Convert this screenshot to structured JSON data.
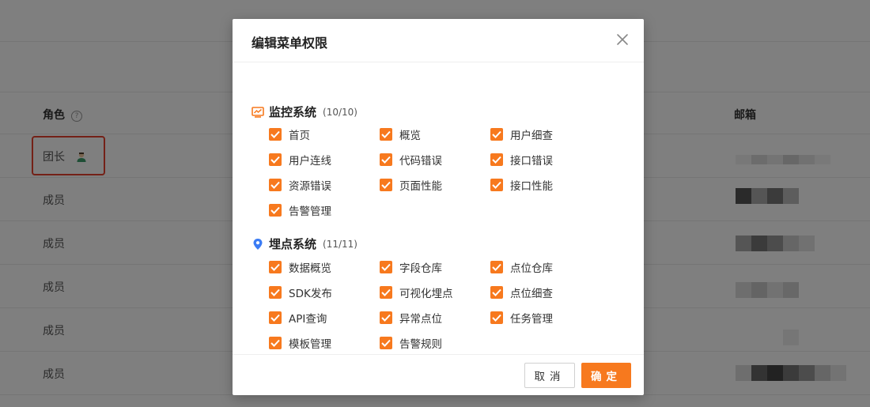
{
  "background": {
    "columns": {
      "role": "角色",
      "email": "邮箱"
    },
    "help_icon": "?",
    "rows": [
      {
        "role": "团长",
        "is_leader": true
      },
      {
        "role": "成员"
      },
      {
        "role": "成员"
      },
      {
        "role": "成员"
      },
      {
        "role": "成员"
      },
      {
        "role": "成员"
      }
    ]
  },
  "modal": {
    "title": "编辑菜单权限",
    "close_icon": "close-icon",
    "sections": [
      {
        "name": "监控系统",
        "count": "(10/10)",
        "icon": "monitor-chart-icon",
        "items": [
          "首页",
          "概览",
          "用户细查",
          "用户连线",
          "代码错误",
          "接口错误",
          "资源错误",
          "页面性能",
          "接口性能",
          "告警管理"
        ]
      },
      {
        "name": "埋点系统",
        "count": "(11/11)",
        "icon": "location-pin-icon",
        "items": [
          "数据概览",
          "字段仓库",
          "点位仓库",
          "SDK发布",
          "可视化埋点",
          "点位细查",
          "API查询",
          "异常点位",
          "任务管理",
          "模板管理",
          "告警规则"
        ]
      }
    ],
    "cancel_label": "取消",
    "ok_label": "确定"
  },
  "colors": {
    "accent": "#f7791e",
    "highlight_border": "#e8432e"
  }
}
